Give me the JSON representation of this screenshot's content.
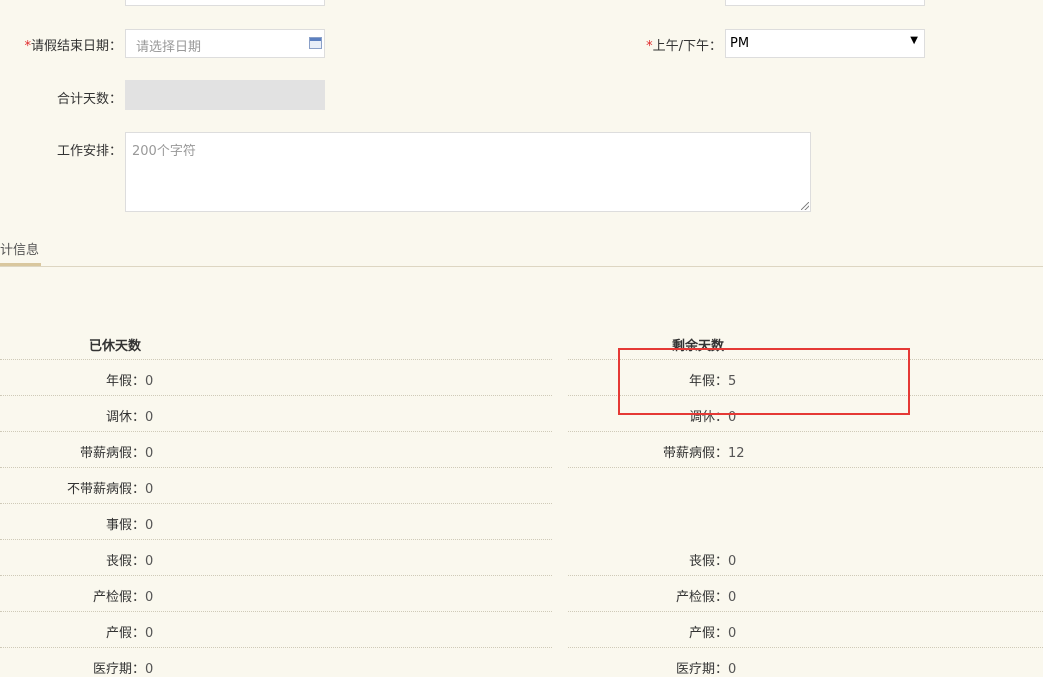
{
  "form": {
    "end_date": {
      "required_mark": "*",
      "label": "请假结束日期：",
      "placeholder": "请选择日期"
    },
    "ampm": {
      "required_mark": "*",
      "label": "上午/下午：",
      "value": "PM"
    },
    "total_days": {
      "label": "合计天数：",
      "value": ""
    },
    "work_arrangement": {
      "label": "工作安排：",
      "placeholder": "200个字符"
    }
  },
  "tab": {
    "label": "计信息"
  },
  "stats": {
    "used_header": "已休天数",
    "remaining_header": "剩余天数",
    "used": [
      {
        "label": "年假：",
        "value": "0"
      },
      {
        "label": "调休：",
        "value": "0"
      },
      {
        "label": "带薪病假：",
        "value": "0"
      },
      {
        "label": "不带薪病假：",
        "value": "0"
      },
      {
        "label": "事假：",
        "value": "0"
      },
      {
        "label": "丧假：",
        "value": "0"
      },
      {
        "label": "产检假：",
        "value": "0"
      },
      {
        "label": "产假：",
        "value": "0"
      },
      {
        "label": "医疗期：",
        "value": "0"
      }
    ],
    "remaining": [
      {
        "label": "年假：",
        "value": "5"
      },
      {
        "label": "调休：",
        "value": "0"
      },
      {
        "label": "带薪病假：",
        "value": "12"
      },
      {
        "label": "丧假：",
        "value": "0"
      },
      {
        "label": "产检假：",
        "value": "0"
      },
      {
        "label": "产假：",
        "value": "0"
      },
      {
        "label": "医疗期：",
        "value": "0"
      }
    ]
  },
  "colors": {
    "background": "#faf8ee",
    "required": "#e0282a",
    "highlight": "#e53935"
  }
}
